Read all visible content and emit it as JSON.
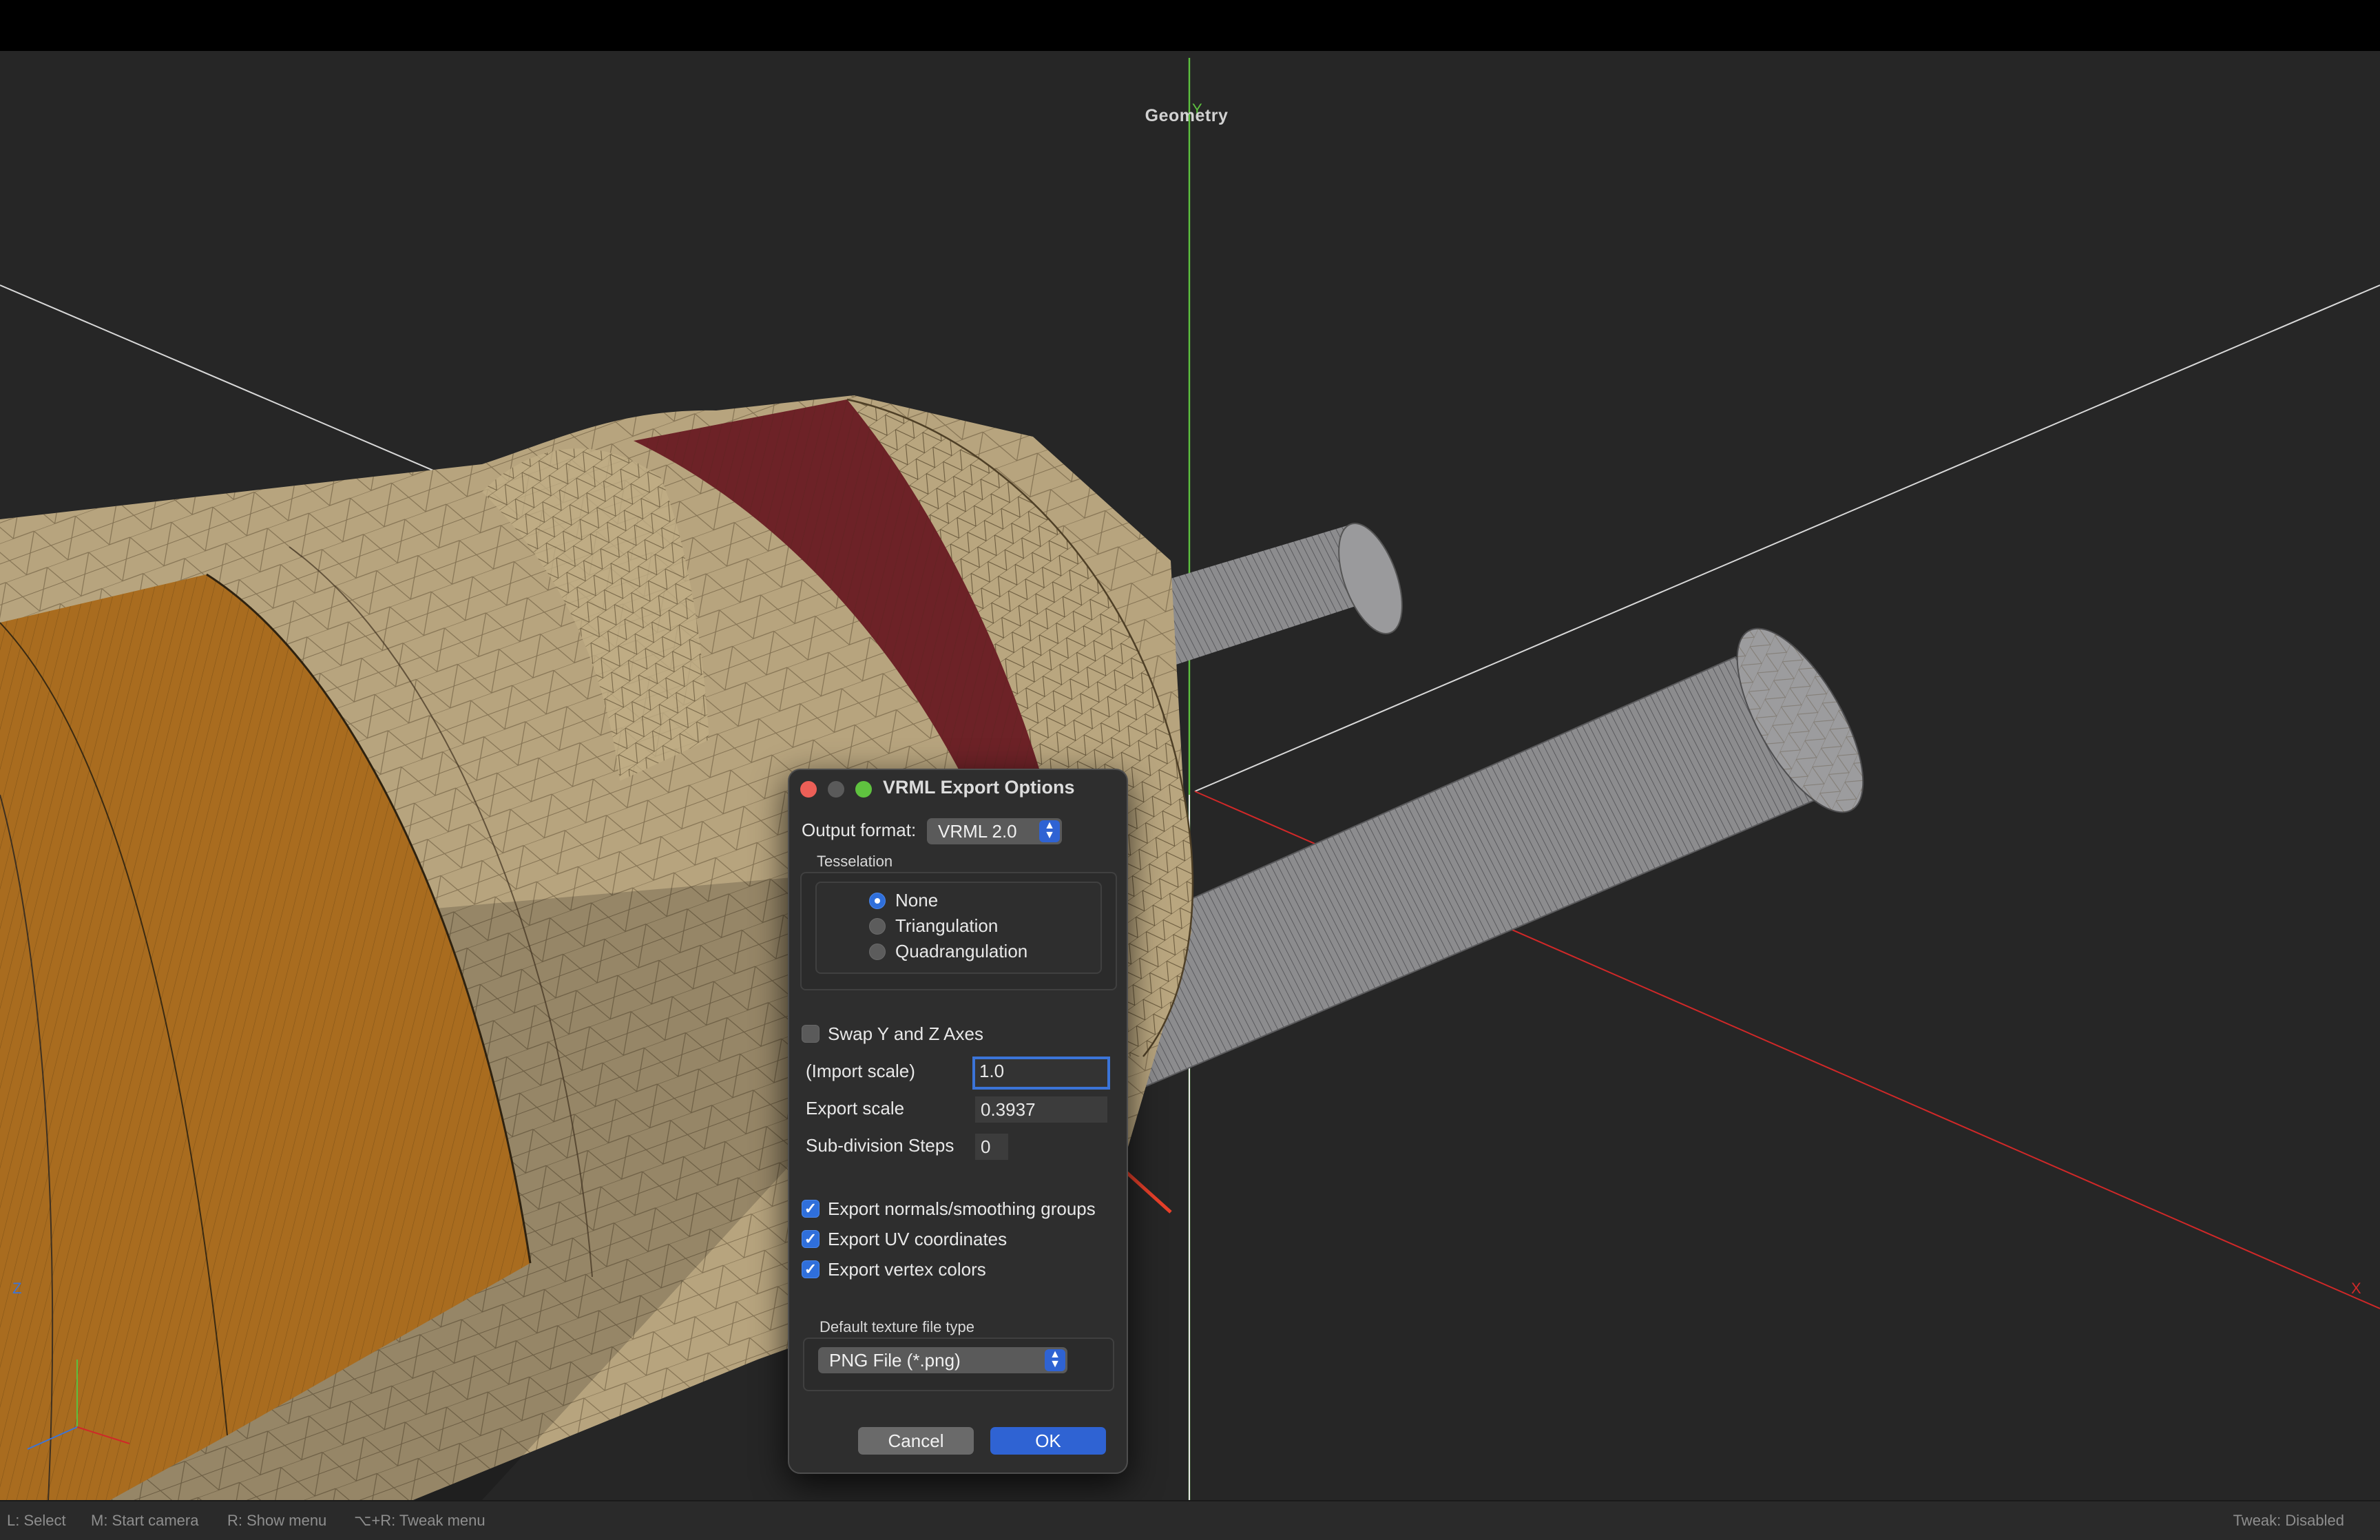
{
  "viewport": {
    "title": "Geometry",
    "axis_labels": {
      "y": "Y",
      "x": "X",
      "z": "Z"
    }
  },
  "dialog": {
    "title": "VRML Export Options",
    "output_format_label": "Output format:",
    "output_format_value": "VRML 2.0",
    "tesselation": {
      "label": "Tesselation",
      "options": [
        "None",
        "Triangulation",
        "Quadrangulation"
      ],
      "selected": "None"
    },
    "swap_axes_label": "Swap Y and Z Axes",
    "swap_axes_checked": false,
    "import_scale_label": "(Import scale)",
    "import_scale_value": "1.0",
    "export_scale_label": "Export scale",
    "export_scale_value": "0.3937",
    "subdivision_label": "Sub-division Steps",
    "subdivision_value": "0",
    "checkboxes": [
      {
        "label": "Export normals/smoothing groups",
        "checked": true
      },
      {
        "label": "Export UV coordinates",
        "checked": true
      },
      {
        "label": "Export vertex colors",
        "checked": true
      }
    ],
    "texture_type_label": "Default texture file type",
    "texture_type_value": "PNG File (*.png)",
    "cancel_label": "Cancel",
    "ok_label": "OK"
  },
  "statusbar": {
    "hints": [
      "L: Select",
      "M: Start camera",
      "R: Show menu",
      "⌥+R: Tweak menu"
    ],
    "right": "Tweak: Disabled"
  },
  "colors": {
    "accent_blue": "#2f63d3",
    "close_red": "#ec5f57",
    "zoom_green": "#5fc23f",
    "annotation_arrow": "#e8402a",
    "mesh_tan": "#b5a27c",
    "mesh_orange": "#a86a1c",
    "mesh_red": "#6e2228",
    "rod_gray": "#8a8a8c"
  }
}
